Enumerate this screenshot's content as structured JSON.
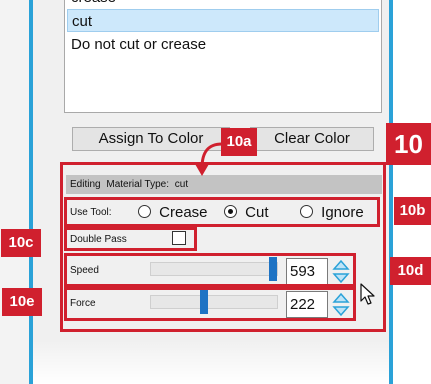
{
  "list": {
    "items": [
      {
        "label": "crease",
        "selected": false
      },
      {
        "label": "cut",
        "selected": true
      },
      {
        "label": "Do not cut or crease",
        "selected": false
      }
    ]
  },
  "buttons": {
    "assign_to_color": "Assign To Color",
    "clear_color": "Clear Color"
  },
  "editing": {
    "editing_label": "Editing",
    "material_type_label": "Material Type:",
    "material_type_value": "cut"
  },
  "use_tool": {
    "label": "Use Tool:",
    "options": [
      "Crease",
      "Cut",
      "Ignore"
    ],
    "selected": "Cut"
  },
  "double_pass": {
    "label": "Double Pass",
    "checked": false
  },
  "speed": {
    "label": "Speed",
    "value": "593",
    "slider_fraction": 0.99
  },
  "force": {
    "label": "Force",
    "value": "222",
    "slider_fraction": 0.42
  },
  "callouts": {
    "main": "10",
    "a": "10a",
    "b": "10b",
    "c": "10c",
    "d": "10d",
    "e": "10e"
  },
  "colors": {
    "annotation_red": "#d0202e",
    "window_blue": "#2aa2d8",
    "slider_blue": "#1e73c4",
    "selected_row": "#cde8fb"
  }
}
